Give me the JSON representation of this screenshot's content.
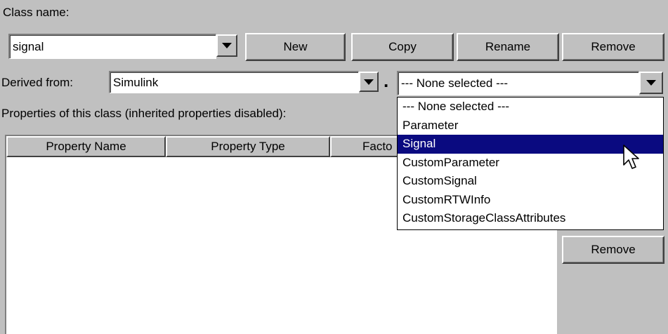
{
  "class_name": {
    "label": "Class name:",
    "value": "signal"
  },
  "buttons": {
    "new": "New",
    "copy": "Copy",
    "rename": "Rename",
    "remove": "Remove",
    "property_remove": "Remove"
  },
  "derived_from": {
    "label": "Derived from:",
    "package_value": "Simulink",
    "separator": ".",
    "class_value": "--- None selected ---"
  },
  "properties": {
    "label": "Properties of this class (inherited properties disabled):",
    "columns": [
      "Property Name",
      "Property Type",
      "Facto"
    ]
  },
  "dropdown": {
    "options": [
      "--- None selected ---",
      "Parameter",
      "Signal",
      "CustomParameter",
      "CustomSignal",
      "CustomRTWInfo",
      "CustomStorageClassAttributes"
    ],
    "selected_index": 2
  },
  "colors": {
    "background": "#c0c0c0",
    "selection": "#0a0a80"
  }
}
